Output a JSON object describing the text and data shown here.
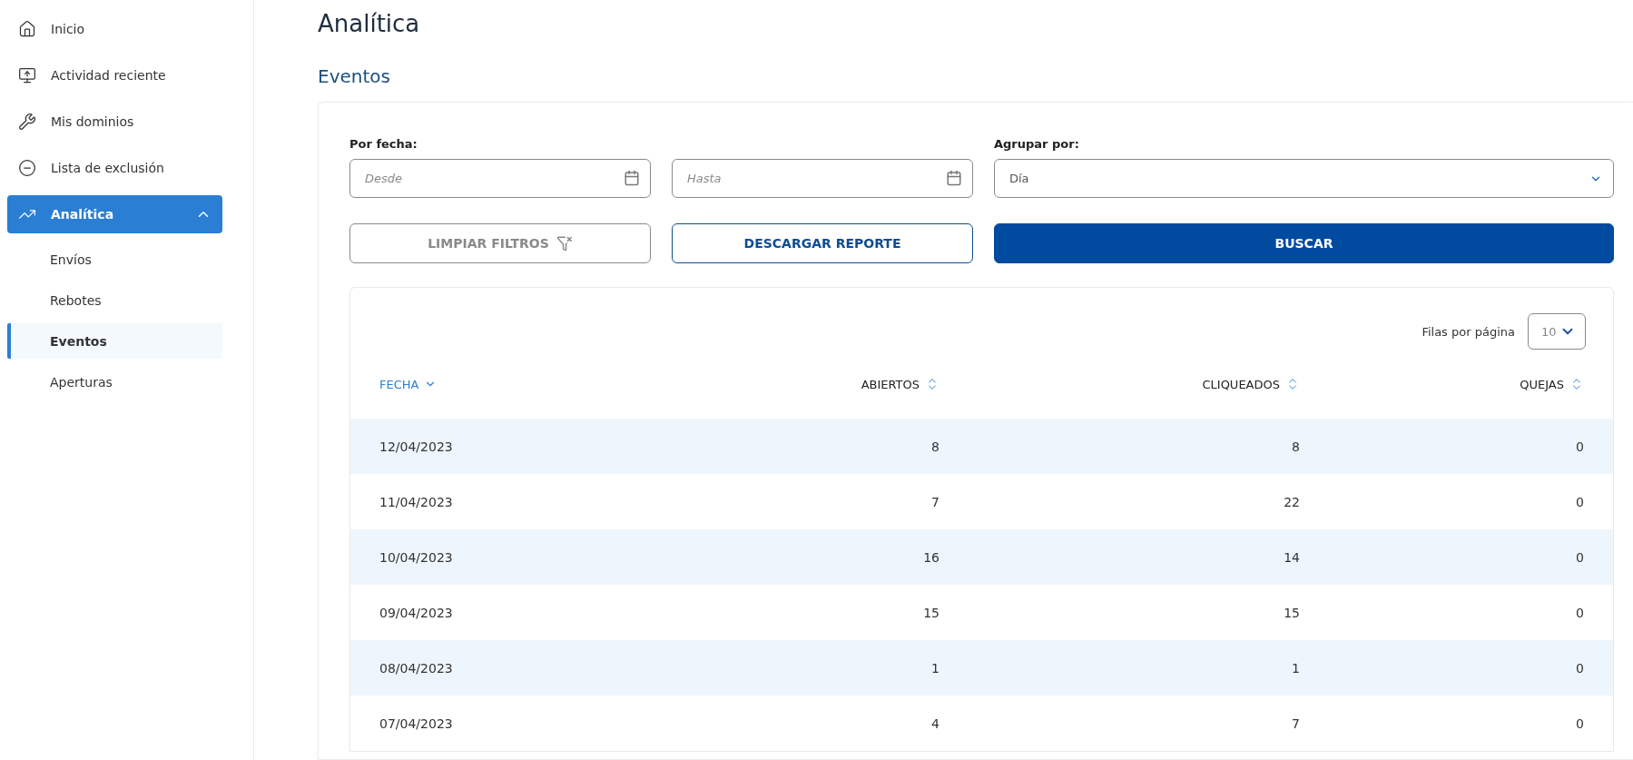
{
  "sidebar": {
    "items": [
      {
        "label": "Inicio",
        "selected": false
      },
      {
        "label": "Actividad reciente",
        "selected": false
      },
      {
        "label": "Mis dominios",
        "selected": false
      },
      {
        "label": "Lista de exclusión",
        "selected": false
      },
      {
        "label": "Analítica",
        "selected": true,
        "expanded": true,
        "children": [
          {
            "label": "Envíos",
            "selected": false
          },
          {
            "label": "Rebotes",
            "selected": false
          },
          {
            "label": "Eventos",
            "selected": true
          },
          {
            "label": "Aperturas",
            "selected": false
          }
        ]
      }
    ]
  },
  "page": {
    "title": "Analítica",
    "subtitle": "Eventos"
  },
  "filters": {
    "date_label": "Por fecha:",
    "from": {
      "placeholder": "Desde"
    },
    "to": {
      "placeholder": "Hasta"
    },
    "group_label": "Agrupar por:",
    "group_value": "Día",
    "buttons": [
      {
        "label": "LIMPIAR FILTROS",
        "kind": "clear"
      },
      {
        "label": "DESCARGAR REPORTE",
        "kind": "outline"
      },
      {
        "label": "BUSCAR",
        "kind": "primary"
      }
    ]
  },
  "table": {
    "rows_per_page_label": "Filas por página",
    "rows_per_page": "10",
    "columns": [
      {
        "label": "FECHA",
        "selected": true
      },
      {
        "label": "ABIERTOS",
        "selected": false
      },
      {
        "label": "CLIQUEADOS",
        "selected": false
      },
      {
        "label": "QUEJAS",
        "selected": false
      }
    ],
    "rows": [
      [
        "12/04/2023",
        "8",
        "8",
        "0"
      ],
      [
        "11/04/2023",
        "7",
        "22",
        "0"
      ],
      [
        "10/04/2023",
        "16",
        "14",
        "0"
      ],
      [
        "09/04/2023",
        "15",
        "15",
        "0"
      ],
      [
        "08/04/2023",
        "1",
        "1",
        "0"
      ],
      [
        "07/04/2023",
        "4",
        "7",
        "0"
      ]
    ]
  }
}
